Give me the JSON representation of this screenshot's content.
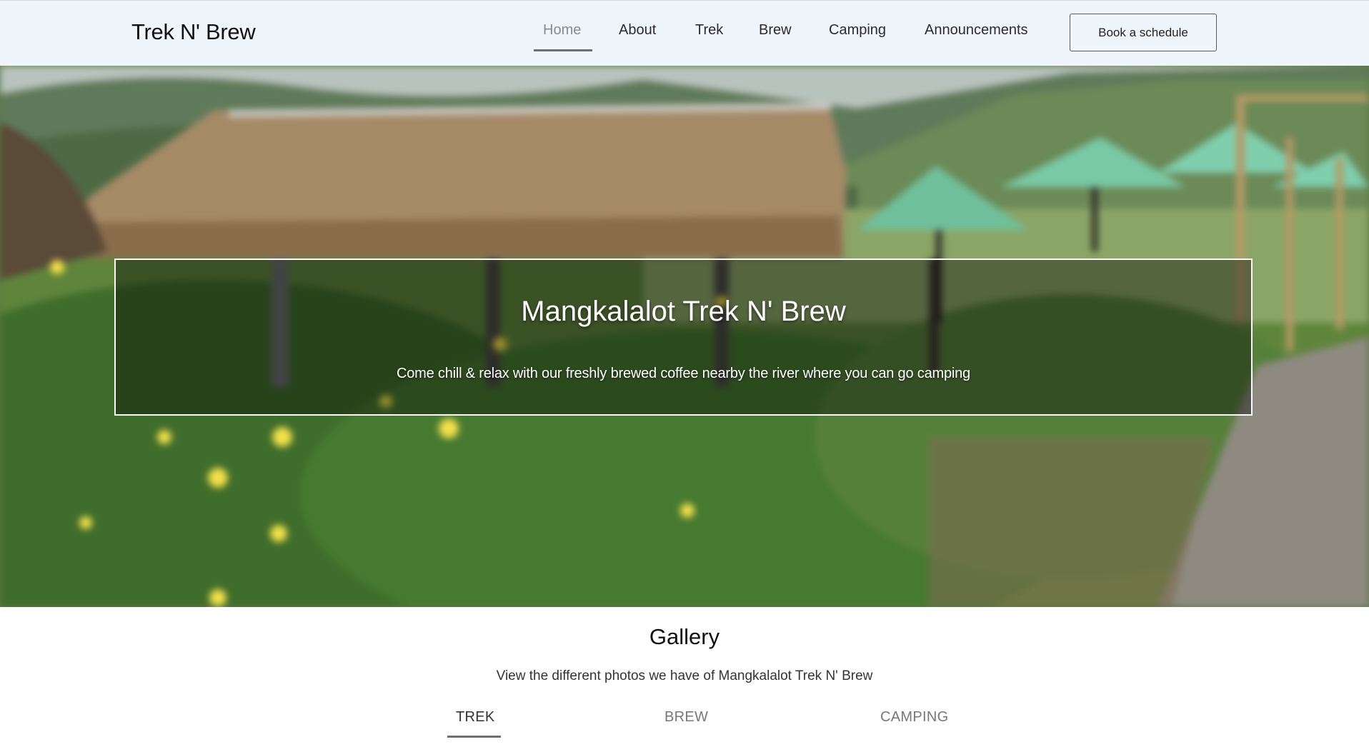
{
  "header": {
    "brand": "Trek N' Brew",
    "nav": [
      {
        "label": "Home",
        "active": true
      },
      {
        "label": "About"
      },
      {
        "label": "Trek"
      },
      {
        "label": "Brew"
      },
      {
        "label": "Camping"
      },
      {
        "label": "Announcements"
      }
    ],
    "cta_label": "Book a schedule"
  },
  "hero": {
    "title": "Mangkalalot Trek N' Brew",
    "subtitle": "Come chill & relax with our freshly brewed coffee nearby the river where you can go camping"
  },
  "gallery": {
    "title": "Gallery",
    "subtitle": "View the different photos we have of Mangkalalot Trek N' Brew",
    "tabs": [
      {
        "label": "TREK",
        "active": true
      },
      {
        "label": "BREW"
      },
      {
        "label": "CAMPING"
      }
    ]
  },
  "colors": {
    "navbar_bg": "#eef5fb",
    "nav_active_text": "#8a8a8a",
    "accent_underline": "#6f6f6f"
  }
}
